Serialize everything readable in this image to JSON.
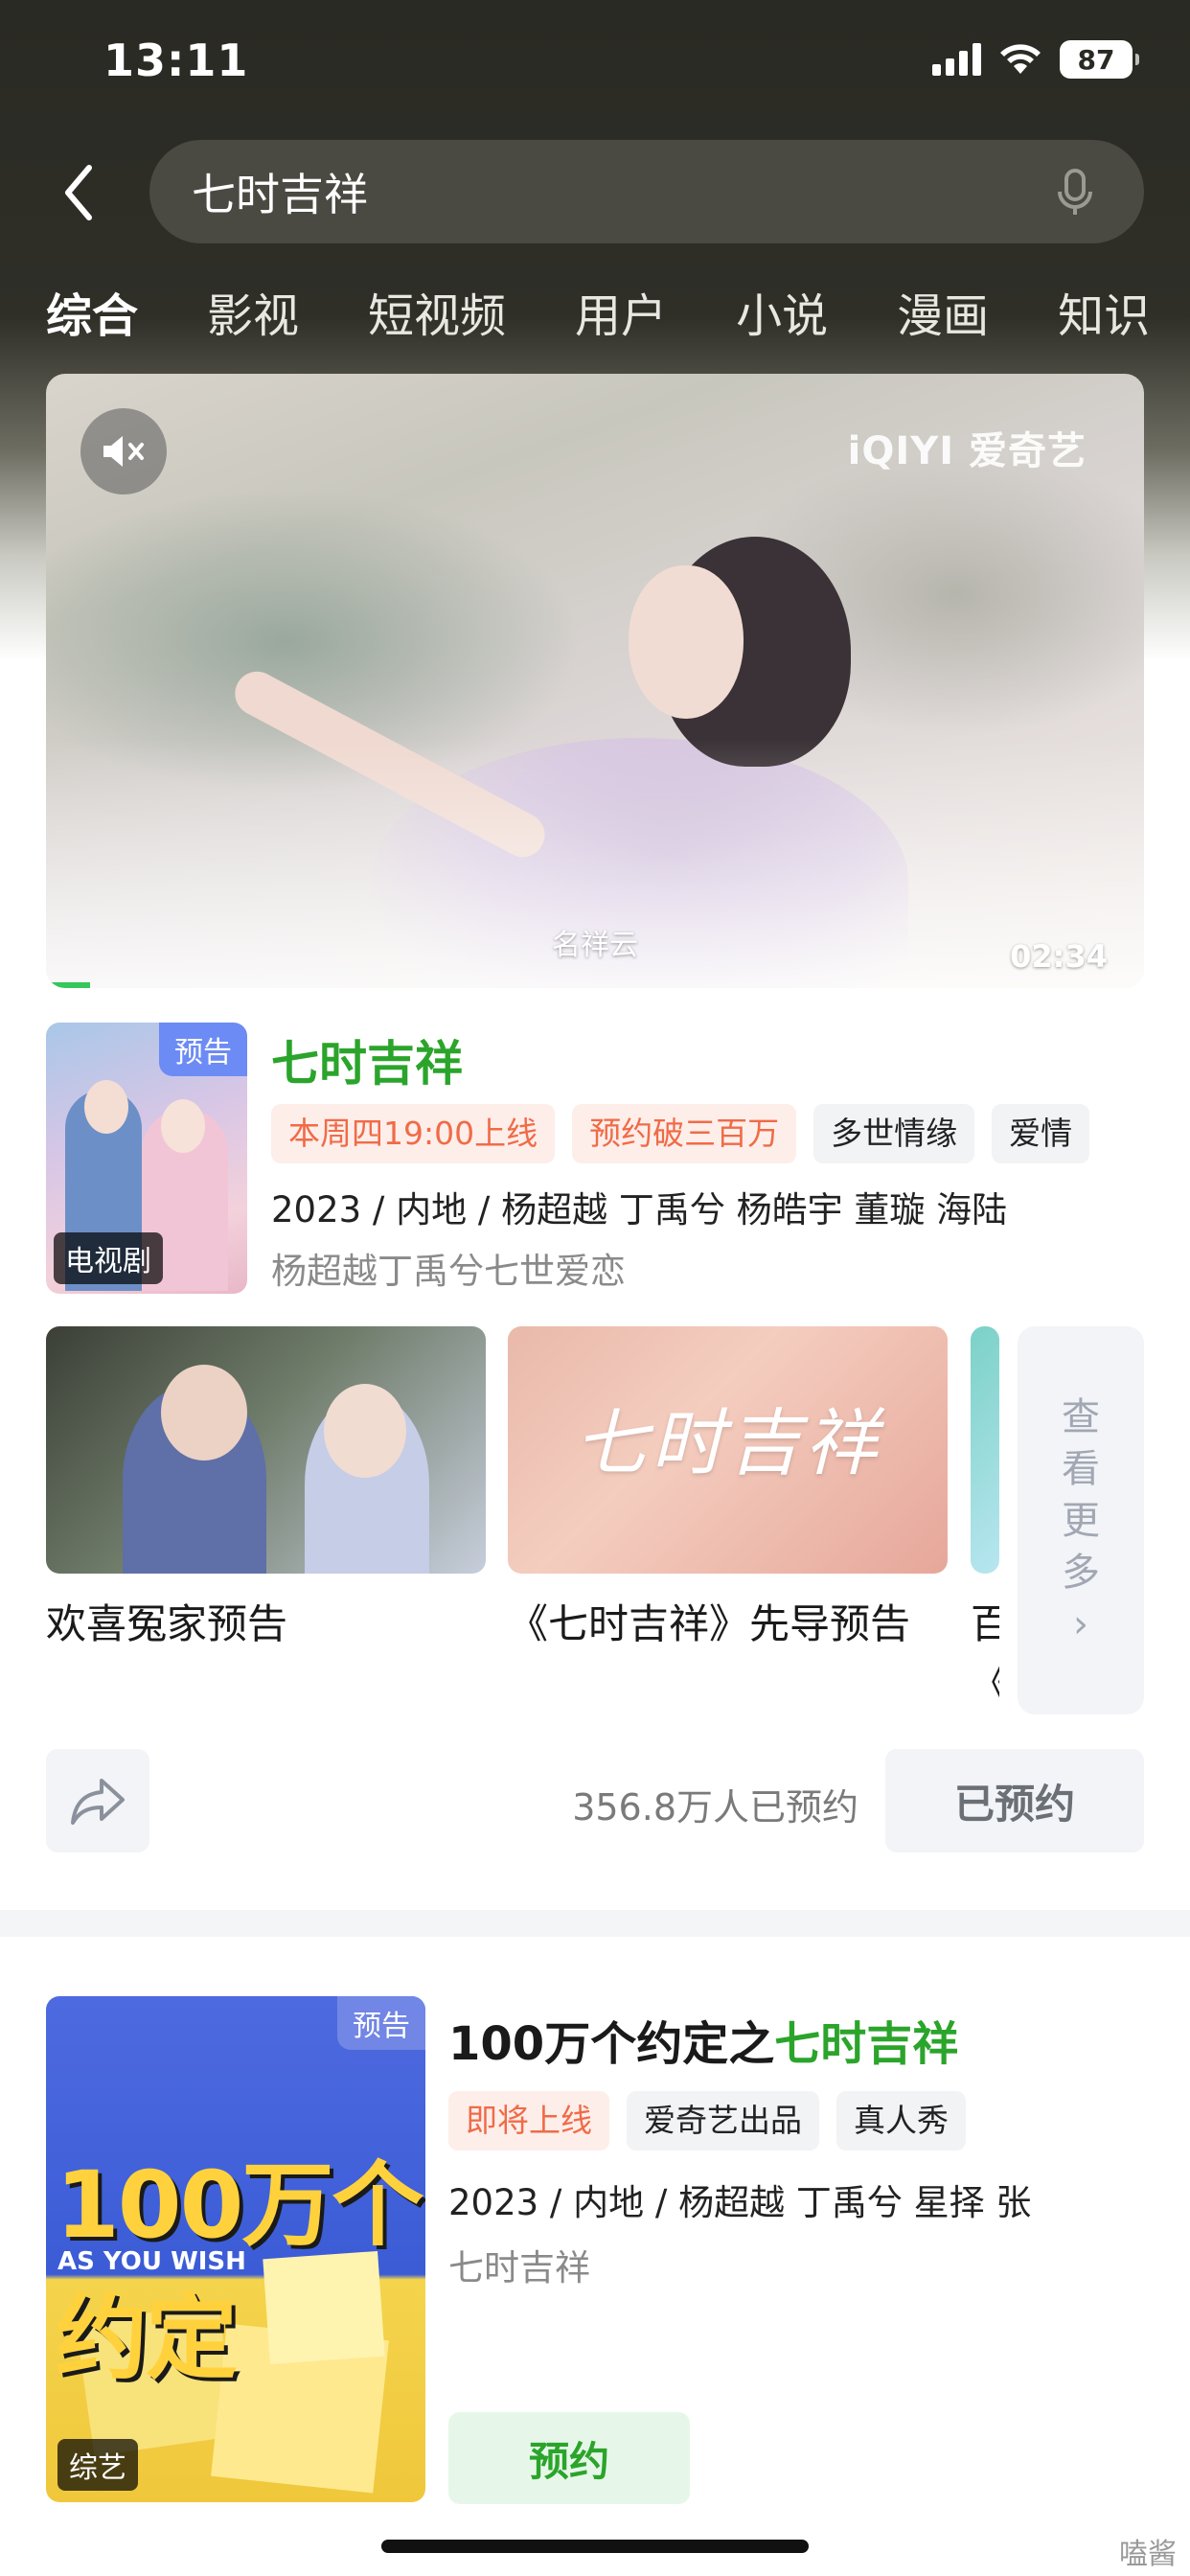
{
  "status_bar": {
    "time": "13:11",
    "battery": "87"
  },
  "search": {
    "query": "七时吉祥"
  },
  "tabs": [
    {
      "label": "综合",
      "active": true
    },
    {
      "label": "影视"
    },
    {
      "label": "短视频"
    },
    {
      "label": "用户"
    },
    {
      "label": "小说"
    },
    {
      "label": "漫画"
    },
    {
      "label": "知识"
    }
  ],
  "video": {
    "brand": "iQIYI 爱奇艺",
    "caption": "名祥云",
    "duration": "02:34",
    "progress_fraction": 0.04
  },
  "show": {
    "badge_top": "预告",
    "badge_type": "电视剧",
    "title": "七时吉祥",
    "tags": [
      {
        "text": "本周四19:00上线",
        "style": "hot"
      },
      {
        "text": "预约破三百万",
        "style": "hot"
      },
      {
        "text": "多世情缘",
        "style": "normal"
      },
      {
        "text": "爱情",
        "style": "normal"
      }
    ],
    "meta": "2023 / 内地 / 杨超越  丁禹兮  杨皓宇  董璇  海陆",
    "desc": "杨超越丁禹兮七世爱恋"
  },
  "trailers": [
    {
      "label": "欢喜冤家预告"
    },
    {
      "label": "《七时吉祥》先导预告",
      "thumb_text": "七时吉祥"
    },
    {
      "label": "百《"
    }
  ],
  "more": {
    "chars": [
      "查",
      "看",
      "更",
      "多",
      "›"
    ]
  },
  "actions": {
    "reserved_count": "356.8万人已预约",
    "reserved_label": "已预约"
  },
  "show2": {
    "badge_top": "预告",
    "badge_type": "综艺",
    "title_prefix": "100万个约定之",
    "title_highlight": "七时吉祥",
    "poster_title": "100万个约定",
    "poster_sub": "AS YOU WISH",
    "tags": [
      {
        "text": "即将上线",
        "style": "hot"
      },
      {
        "text": "爱奇艺出品",
        "style": "normal"
      },
      {
        "text": "真人秀",
        "style": "normal"
      }
    ],
    "meta": "2023 / 内地 / 杨超越  丁禹兮  星择  张",
    "desc": "七时吉祥",
    "book_label": "预约"
  },
  "watermark": "嗑酱",
  "colors": {
    "accent_green": "#2ba42b",
    "hot_tag": "#f06b47",
    "badge_blue": "#6d8bf5"
  }
}
